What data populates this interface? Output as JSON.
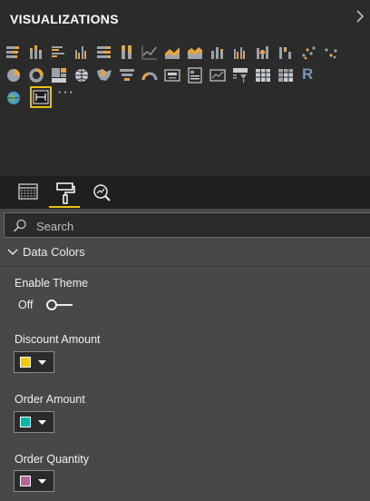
{
  "panel": {
    "title": "VISUALIZATIONS"
  },
  "visuals": [
    "stacked-bar-chart-icon",
    "stacked-column-chart-icon",
    "clustered-bar-chart-icon",
    "clustered-column-chart-icon",
    "100-percent-stacked-bar-chart-icon",
    "100-percent-stacked-column-chart-icon",
    "line-chart-icon",
    "area-chart-icon",
    "stacked-area-chart-icon",
    "line-and-stacked-column-chart-icon",
    "line-and-clustered-column-chart-icon",
    "ribbon-chart-icon",
    "waterfall-chart-icon",
    "scatter-chart-icon",
    "pie-chart-icon",
    "donut-chart-icon",
    "treemap-icon",
    "map-icon",
    "filled-map-icon",
    "funnel-icon",
    "gauge-icon",
    "card-icon",
    "multi-row-card-icon",
    "kpi-icon",
    "slicer-icon",
    "table-icon",
    "matrix-icon",
    "r-script-visual-icon",
    "arcgis-map-icon",
    "custom-visual-icon",
    "more-options-icon"
  ],
  "visual_r_text": "R",
  "visual_more_text": "···",
  "tabs": [
    {
      "name": "fields",
      "active": false
    },
    {
      "name": "format",
      "active": true
    },
    {
      "name": "analytics",
      "active": false
    }
  ],
  "search": {
    "placeholder": "Search"
  },
  "section": {
    "label": "Data Colors",
    "expanded": true
  },
  "enable_theme": {
    "label": "Enable Theme",
    "value": "Off"
  },
  "series": [
    {
      "label": "Discount Amount",
      "color": "#f2c80f"
    },
    {
      "label": "Order Amount",
      "color": "#01b8aa"
    },
    {
      "label": "Order Quantity",
      "color": "#b4669a"
    }
  ],
  "colors": {
    "accent": "#e7c214",
    "panel_dark": "#2b2b2b",
    "pane_bg": "#484848"
  }
}
